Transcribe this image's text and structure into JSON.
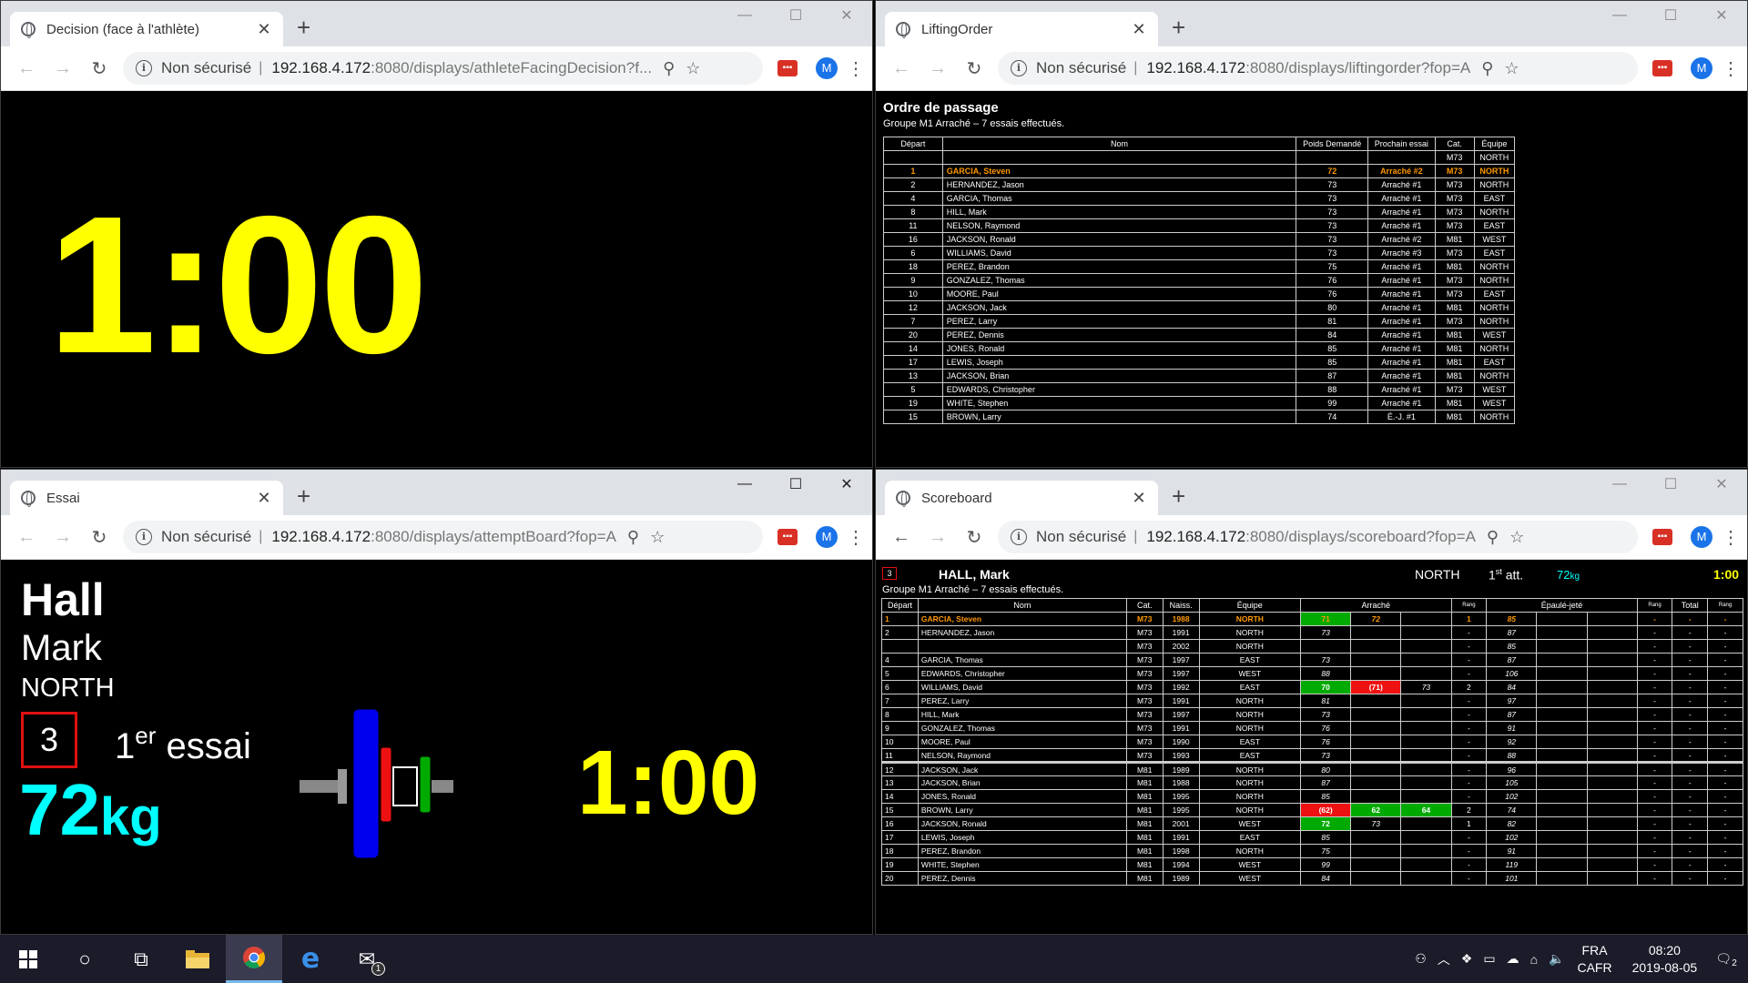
{
  "windows": {
    "decision": {
      "tab_title": "Decision (face à l'athlète)",
      "url_host": "192.168.4.172",
      "url_path": ":8080/displays/athleteFacingDecision?f...",
      "timer": "1:00"
    },
    "lifting": {
      "tab_title": "LiftingOrder",
      "url_host": "192.168.4.172",
      "url_path": ":8080/displays/liftingorder?fop=A",
      "title": "Ordre de passage",
      "subtitle": "Groupe M1 Arraché – 7 essais effectués.",
      "headers": [
        "Départ",
        "Nom",
        "Poids Demandé",
        "Prochain essai",
        "Cat.",
        "Équipe"
      ],
      "rows": [
        [
          "",
          "",
          "",
          "",
          "M73",
          "NORTH"
        ],
        [
          "1",
          "GARCIA, Steven",
          "72",
          "Arraché #2",
          "M73",
          "NORTH"
        ],
        [
          "2",
          "HERNANDEZ, Jason",
          "73",
          "Arraché #1",
          "M73",
          "NORTH"
        ],
        [
          "4",
          "GARCIA, Thomas",
          "73",
          "Arraché #1",
          "M73",
          "EAST"
        ],
        [
          "8",
          "HILL, Mark",
          "73",
          "Arraché #1",
          "M73",
          "NORTH"
        ],
        [
          "11",
          "NELSON, Raymond",
          "73",
          "Arraché #1",
          "M73",
          "EAST"
        ],
        [
          "16",
          "JACKSON, Ronald",
          "73",
          "Arraché #2",
          "M81",
          "WEST"
        ],
        [
          "6",
          "WILLIAMS, David",
          "73",
          "Arraché #3",
          "M73",
          "EAST"
        ],
        [
          "18",
          "PEREZ, Brandon",
          "75",
          "Arraché #1",
          "M81",
          "NORTH"
        ],
        [
          "9",
          "GONZALEZ, Thomas",
          "76",
          "Arraché #1",
          "M73",
          "NORTH"
        ],
        [
          "10",
          "MOORE, Paul",
          "76",
          "Arraché #1",
          "M73",
          "EAST"
        ],
        [
          "12",
          "JACKSON, Jack",
          "80",
          "Arraché #1",
          "M81",
          "NORTH"
        ],
        [
          "7",
          "PEREZ, Larry",
          "81",
          "Arraché #1",
          "M73",
          "NORTH"
        ],
        [
          "20",
          "PEREZ, Dennis",
          "84",
          "Arraché #1",
          "M81",
          "WEST"
        ],
        [
          "14",
          "JONES, Ronald",
          "85",
          "Arraché #1",
          "M81",
          "NORTH"
        ],
        [
          "17",
          "LEWIS, Joseph",
          "85",
          "Arraché #1",
          "M81",
          "EAST"
        ],
        [
          "13",
          "JACKSON, Brian",
          "87",
          "Arraché #1",
          "M81",
          "NORTH"
        ],
        [
          "5",
          "EDWARDS, Christopher",
          "88",
          "Arraché #1",
          "M73",
          "WEST"
        ],
        [
          "19",
          "WHITE, Stephen",
          "99",
          "Arraché #1",
          "M81",
          "WEST"
        ],
        [
          "15",
          "BROWN, Larry",
          "74",
          "É.-J. #1",
          "M81",
          "NORTH"
        ]
      ]
    },
    "essai": {
      "tab_title": "Essai",
      "url_host": "192.168.4.172",
      "url_path": ":8080/displays/attemptBoard?fop=A",
      "last_name": "Hall",
      "first_name": "Mark",
      "team": "NORTH",
      "start_number": "3",
      "attempt_num": "1",
      "attempt_sup": "er",
      "attempt_word": "essai",
      "weight": "72",
      "weight_unit": "kg",
      "timer": "1:00",
      "plate_colors": [
        "#0000ee",
        "#ee1111",
        "#ffffff",
        "#00aa00"
      ]
    },
    "score": {
      "tab_title": "Scoreboard",
      "url_host": "192.168.4.172",
      "url_path": ":8080/displays/scoreboard?fop=A",
      "start_number": "3",
      "athlete": "HALL, Mark",
      "team": "NORTH",
      "attempt_num": "1",
      "attempt_sup": "st",
      "attempt_word": "att.",
      "weight_value": "72",
      "weight_unit": "kg",
      "timer": "1:00",
      "group": "Groupe M1 Arraché – 7 essais effectués.",
      "headers": [
        "Départ",
        "Nom",
        "Cat.",
        "Naiss.",
        "Équipe",
        "Arraché",
        "Rang",
        "Épaulé-jeté",
        "Rang",
        "Total",
        "Rang"
      ],
      "rows": [
        {
          "st": "1",
          "name": "GARCIA, Steven",
          "cat": "M73",
          "yr": "1988",
          "team": "NORTH",
          "sn": [
            {
              "v": "71",
              "s": "good"
            },
            {
              "v": "72",
              "s": "req"
            },
            {
              "v": "",
              "s": ""
            }
          ],
          "snr": "1",
          "cj": [
            {
              "v": "85",
              "s": "req"
            },
            {
              "v": "",
              "s": ""
            },
            {
              "v": "",
              "s": ""
            }
          ],
          "cjr": "-",
          "tot": "-",
          "tr": "-",
          "cur": true
        },
        {
          "st": "2",
          "name": "HERNANDEZ, Jason",
          "cat": "M73",
          "yr": "1991",
          "team": "NORTH",
          "sn": [
            {
              "v": "73",
              "s": "req"
            },
            {
              "v": "",
              "s": ""
            },
            {
              "v": "",
              "s": ""
            }
          ],
          "snr": "-",
          "cj": [
            {
              "v": "87",
              "s": "req"
            },
            {
              "v": "",
              "s": ""
            },
            {
              "v": "",
              "s": ""
            }
          ],
          "cjr": "-",
          "tot": "-",
          "tr": "-"
        },
        {
          "st": "",
          "name": "",
          "cat": "M73",
          "yr": "2002",
          "team": "NORTH",
          "sn": [
            {
              "v": "",
              "s": ""
            },
            {
              "v": "",
              "s": ""
            },
            {
              "v": "",
              "s": ""
            }
          ],
          "snr": "-",
          "cj": [
            {
              "v": "85",
              "s": "req"
            },
            {
              "v": "",
              "s": ""
            },
            {
              "v": "",
              "s": ""
            }
          ],
          "cjr": "-",
          "tot": "-",
          "tr": "-"
        },
        {
          "st": "4",
          "name": "GARCIA, Thomas",
          "cat": "M73",
          "yr": "1997",
          "team": "EAST",
          "sn": [
            {
              "v": "73",
              "s": "req"
            },
            {
              "v": "",
              "s": ""
            },
            {
              "v": "",
              "s": ""
            }
          ],
          "snr": "-",
          "cj": [
            {
              "v": "87",
              "s": "req"
            },
            {
              "v": "",
              "s": ""
            },
            {
              "v": "",
              "s": ""
            }
          ],
          "cjr": "-",
          "tot": "-",
          "tr": "-"
        },
        {
          "st": "5",
          "name": "EDWARDS, Christopher",
          "cat": "M73",
          "yr": "1997",
          "team": "WEST",
          "sn": [
            {
              "v": "88",
              "s": "req"
            },
            {
              "v": "",
              "s": ""
            },
            {
              "v": "",
              "s": ""
            }
          ],
          "snr": "-",
          "cj": [
            {
              "v": "106",
              "s": "req"
            },
            {
              "v": "",
              "s": ""
            },
            {
              "v": "",
              "s": ""
            }
          ],
          "cjr": "-",
          "tot": "-",
          "tr": "-"
        },
        {
          "st": "6",
          "name": "WILLIAMS, David",
          "cat": "M73",
          "yr": "1992",
          "team": "EAST",
          "sn": [
            {
              "v": "70",
              "s": "good"
            },
            {
              "v": "(71)",
              "s": "bad"
            },
            {
              "v": "73",
              "s": "req"
            }
          ],
          "snr": "2",
          "cj": [
            {
              "v": "84",
              "s": "req"
            },
            {
              "v": "",
              "s": ""
            },
            {
              "v": "",
              "s": ""
            }
          ],
          "cjr": "-",
          "tot": "-",
          "tr": "-"
        },
        {
          "st": "7",
          "name": "PEREZ, Larry",
          "cat": "M73",
          "yr": "1991",
          "team": "NORTH",
          "sn": [
            {
              "v": "81",
              "s": "req"
            },
            {
              "v": "",
              "s": ""
            },
            {
              "v": "",
              "s": ""
            }
          ],
          "snr": "-",
          "cj": [
            {
              "v": "97",
              "s": "req"
            },
            {
              "v": "",
              "s": ""
            },
            {
              "v": "",
              "s": ""
            }
          ],
          "cjr": "-",
          "tot": "-",
          "tr": "-"
        },
        {
          "st": "8",
          "name": "HILL, Mark",
          "cat": "M73",
          "yr": "1997",
          "team": "NORTH",
          "sn": [
            {
              "v": "73",
              "s": "req"
            },
            {
              "v": "",
              "s": ""
            },
            {
              "v": "",
              "s": ""
            }
          ],
          "snr": "-",
          "cj": [
            {
              "v": "87",
              "s": "req"
            },
            {
              "v": "",
              "s": ""
            },
            {
              "v": "",
              "s": ""
            }
          ],
          "cjr": "-",
          "tot": "-",
          "tr": "-"
        },
        {
          "st": "9",
          "name": "GONZALEZ, Thomas",
          "cat": "M73",
          "yr": "1991",
          "team": "NORTH",
          "sn": [
            {
              "v": "76",
              "s": "req"
            },
            {
              "v": "",
              "s": ""
            },
            {
              "v": "",
              "s": ""
            }
          ],
          "snr": "-",
          "cj": [
            {
              "v": "91",
              "s": "req"
            },
            {
              "v": "",
              "s": ""
            },
            {
              "v": "",
              "s": ""
            }
          ],
          "cjr": "-",
          "tot": "-",
          "tr": "-"
        },
        {
          "st": "10",
          "name": "MOORE, Paul",
          "cat": "M73",
          "yr": "1990",
          "team": "EAST",
          "sn": [
            {
              "v": "76",
              "s": "req"
            },
            {
              "v": "",
              "s": ""
            },
            {
              "v": "",
              "s": ""
            }
          ],
          "snr": "-",
          "cj": [
            {
              "v": "92",
              "s": "req"
            },
            {
              "v": "",
              "s": ""
            },
            {
              "v": "",
              "s": ""
            }
          ],
          "cjr": "-",
          "tot": "-",
          "tr": "-"
        },
        {
          "st": "11",
          "name": "NELSON, Raymond",
          "cat": "M73",
          "yr": "1993",
          "team": "EAST",
          "sn": [
            {
              "v": "73",
              "s": "req"
            },
            {
              "v": "",
              "s": ""
            },
            {
              "v": "",
              "s": ""
            }
          ],
          "snr": "-",
          "cj": [
            {
              "v": "88",
              "s": "req"
            },
            {
              "v": "",
              "s": ""
            },
            {
              "v": "",
              "s": ""
            }
          ],
          "cjr": "-",
          "tot": "-",
          "tr": "-"
        },
        {
          "st": "12",
          "name": "JACKSON, Jack",
          "cat": "M81",
          "yr": "1989",
          "team": "NORTH",
          "sn": [
            {
              "v": "80",
              "s": "req"
            },
            {
              "v": "",
              "s": ""
            },
            {
              "v": "",
              "s": ""
            }
          ],
          "snr": "-",
          "cj": [
            {
              "v": "96",
              "s": "req"
            },
            {
              "v": "",
              "s": ""
            },
            {
              "v": "",
              "s": ""
            }
          ],
          "cjr": "-",
          "tot": "-",
          "tr": "-",
          "sep": true
        },
        {
          "st": "13",
          "name": "JACKSON, Brian",
          "cat": "M81",
          "yr": "1988",
          "team": "NORTH",
          "sn": [
            {
              "v": "87",
              "s": "req"
            },
            {
              "v": "",
              "s": ""
            },
            {
              "v": "",
              "s": ""
            }
          ],
          "snr": "-",
          "cj": [
            {
              "v": "105",
              "s": "req"
            },
            {
              "v": "",
              "s": ""
            },
            {
              "v": "",
              "s": ""
            }
          ],
          "cjr": "-",
          "tot": "-",
          "tr": "-"
        },
        {
          "st": "14",
          "name": "JONES, Ronald",
          "cat": "M81",
          "yr": "1995",
          "team": "NORTH",
          "sn": [
            {
              "v": "85",
              "s": "req"
            },
            {
              "v": "",
              "s": ""
            },
            {
              "v": "",
              "s": ""
            }
          ],
          "snr": "-",
          "cj": [
            {
              "v": "102",
              "s": "req"
            },
            {
              "v": "",
              "s": ""
            },
            {
              "v": "",
              "s": ""
            }
          ],
          "cjr": "-",
          "tot": "-",
          "tr": "-"
        },
        {
          "st": "15",
          "name": "BROWN, Larry",
          "cat": "M81",
          "yr": "1995",
          "team": "NORTH",
          "sn": [
            {
              "v": "(62)",
              "s": "bad"
            },
            {
              "v": "62",
              "s": "good"
            },
            {
              "v": "64",
              "s": "good"
            }
          ],
          "snr": "2",
          "cj": [
            {
              "v": "74",
              "s": "req"
            },
            {
              "v": "",
              "s": ""
            },
            {
              "v": "",
              "s": ""
            }
          ],
          "cjr": "-",
          "tot": "-",
          "tr": "-"
        },
        {
          "st": "16",
          "name": "JACKSON, Ronald",
          "cat": "M81",
          "yr": "2001",
          "team": "WEST",
          "sn": [
            {
              "v": "72",
              "s": "good"
            },
            {
              "v": "73",
              "s": "req"
            },
            {
              "v": "",
              "s": ""
            }
          ],
          "snr": "1",
          "cj": [
            {
              "v": "82",
              "s": "req"
            },
            {
              "v": "",
              "s": ""
            },
            {
              "v": "",
              "s": ""
            }
          ],
          "cjr": "-",
          "tot": "-",
          "tr": "-"
        },
        {
          "st": "17",
          "name": "LEWIS, Joseph",
          "cat": "M81",
          "yr": "1991",
          "team": "EAST",
          "sn": [
            {
              "v": "85",
              "s": "req"
            },
            {
              "v": "",
              "s": ""
            },
            {
              "v": "",
              "s": ""
            }
          ],
          "snr": "-",
          "cj": [
            {
              "v": "102",
              "s": "req"
            },
            {
              "v": "",
              "s": ""
            },
            {
              "v": "",
              "s": ""
            }
          ],
          "cjr": "-",
          "tot": "-",
          "tr": "-"
        },
        {
          "st": "18",
          "name": "PEREZ, Brandon",
          "cat": "M81",
          "yr": "1998",
          "team": "NORTH",
          "sn": [
            {
              "v": "75",
              "s": "req"
            },
            {
              "v": "",
              "s": ""
            },
            {
              "v": "",
              "s": ""
            }
          ],
          "snr": "-",
          "cj": [
            {
              "v": "91",
              "s": "req"
            },
            {
              "v": "",
              "s": ""
            },
            {
              "v": "",
              "s": ""
            }
          ],
          "cjr": "-",
          "tot": "-",
          "tr": "-"
        },
        {
          "st": "19",
          "name": "WHITE, Stephen",
          "cat": "M81",
          "yr": "1994",
          "team": "WEST",
          "sn": [
            {
              "v": "99",
              "s": "req"
            },
            {
              "v": "",
              "s": ""
            },
            {
              "v": "",
              "s": ""
            }
          ],
          "snr": "-",
          "cj": [
            {
              "v": "119",
              "s": "req"
            },
            {
              "v": "",
              "s": ""
            },
            {
              "v": "",
              "s": ""
            }
          ],
          "cjr": "-",
          "tot": "-",
          "tr": "-"
        },
        {
          "st": "20",
          "name": "PEREZ, Dennis",
          "cat": "M81",
          "yr": "1989",
          "team": "WEST",
          "sn": [
            {
              "v": "84",
              "s": "req"
            },
            {
              "v": "",
              "s": ""
            },
            {
              "v": "",
              "s": ""
            }
          ],
          "snr": "-",
          "cj": [
            {
              "v": "101",
              "s": "req"
            },
            {
              "v": "",
              "s": ""
            },
            {
              "v": "",
              "s": ""
            }
          ],
          "cjr": "-",
          "tot": "-",
          "tr": "-"
        }
      ]
    }
  },
  "browser": {
    "not_secure": "Non sécurisé",
    "profile_initial": "M"
  },
  "taskbar": {
    "lang_line1": "FRA",
    "lang_line2": "CAFR",
    "time": "08:20",
    "date": "2019-08-05",
    "notification_count": "2",
    "mail_badge": "1"
  }
}
